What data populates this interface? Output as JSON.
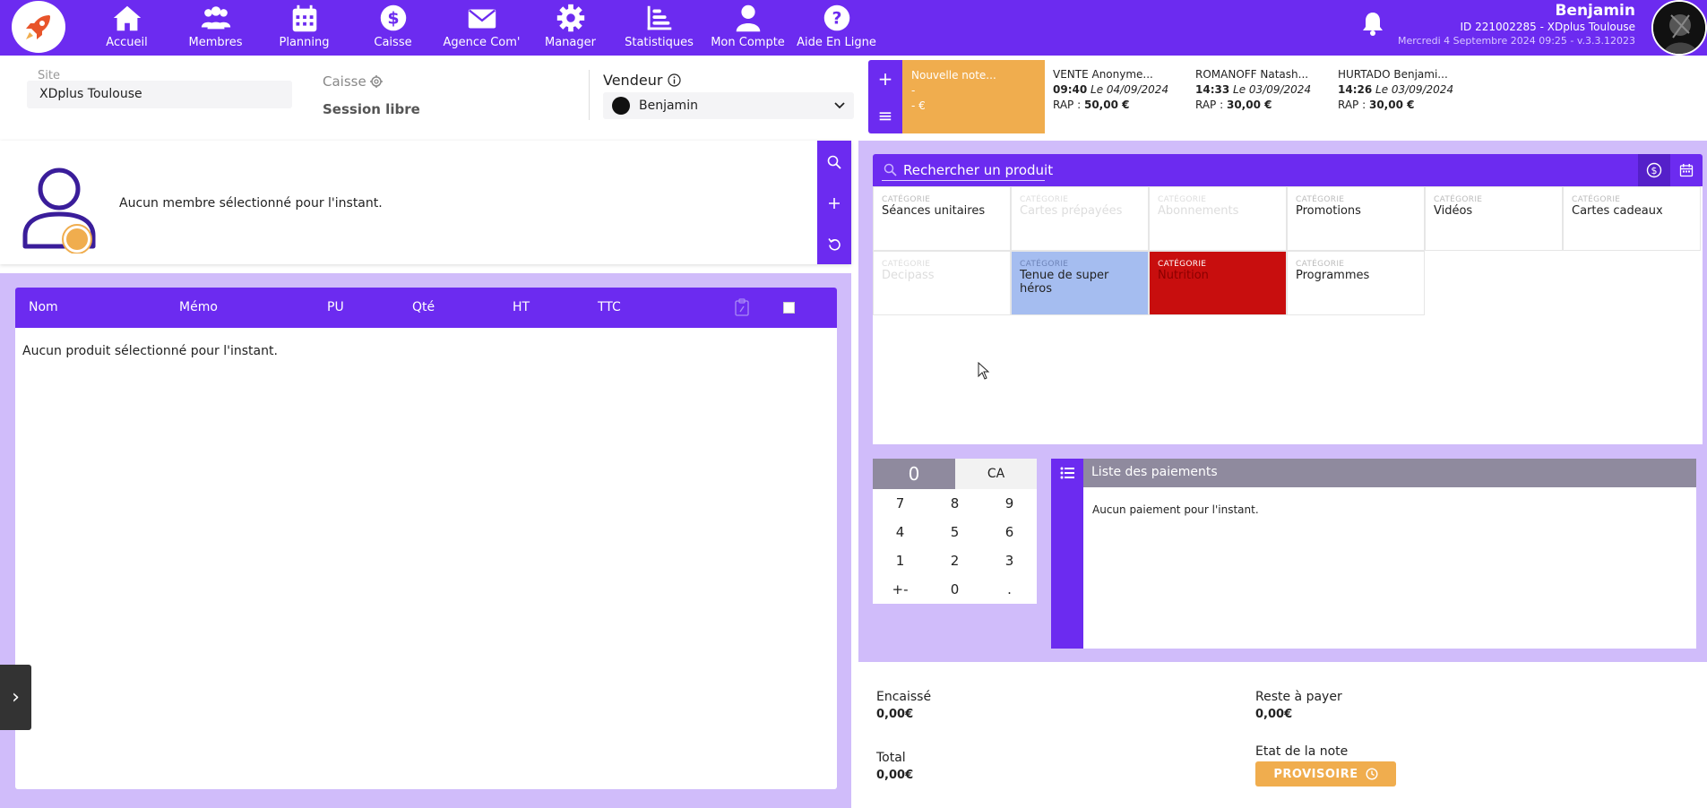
{
  "nav": {
    "items": [
      {
        "label": "Accueil",
        "icon": "home-icon"
      },
      {
        "label": "Membres",
        "icon": "users-icon"
      },
      {
        "label": "Planning",
        "icon": "calendar-icon"
      },
      {
        "label": "Caisse",
        "icon": "dollar-icon"
      },
      {
        "label": "Agence Com'",
        "icon": "envelope-icon"
      },
      {
        "label": "Manager",
        "icon": "gear-icon"
      },
      {
        "label": "Statistiques",
        "icon": "chart-icon"
      },
      {
        "label": "Mon Compte",
        "icon": "user-icon"
      },
      {
        "label": "Aide En Ligne",
        "icon": "help-icon"
      }
    ]
  },
  "user": {
    "name": "Benjamin",
    "id_line": "ID 221002285 - XDplus Toulouse",
    "date_line": "Mercredi 4 Septembre 2024 09:25 - v.3.3.12023"
  },
  "info": {
    "site_label": "Site",
    "site_value": "XDplus Toulouse",
    "caisse_label": "Caisse",
    "session": "Session libre",
    "vendeur_label": "Vendeur",
    "vendeur_value": "Benjamin"
  },
  "notes": {
    "new": {
      "title": "Nouvelle note...",
      "line2": "-",
      "line3": "- €"
    },
    "cards": [
      {
        "name": "VENTE Anonyme...",
        "time": "09:40",
        "date": "Le 04/09/2024",
        "rap_label": "RAP :",
        "rap_value": "50,00 €"
      },
      {
        "name": "ROMANOFF Natash...",
        "time": "14:33",
        "date": "Le 03/09/2024",
        "rap_label": "RAP :",
        "rap_value": "30,00 €"
      },
      {
        "name": "HURTADO Benjami...",
        "time": "14:26",
        "date": "Le 03/09/2024",
        "rap_label": "RAP :",
        "rap_value": "30,00 €"
      }
    ]
  },
  "member": {
    "empty_text": "Aucun membre sélectionné pour l'instant."
  },
  "products": {
    "columns": [
      "Nom",
      "Mémo",
      "PU",
      "Qté",
      "HT",
      "TTC"
    ],
    "empty_text": "Aucun produit sélectionné pour l'instant."
  },
  "catalog": {
    "search_placeholder": "Rechercher un produit",
    "category_key": "CATÉGORIE",
    "categories": [
      {
        "name": "Séances unitaires",
        "state": "normal"
      },
      {
        "name": "Cartes prépayées",
        "state": "faded"
      },
      {
        "name": "Abonnements",
        "state": "faded"
      },
      {
        "name": "Promotions",
        "state": "normal"
      },
      {
        "name": "Vidéos",
        "state": "normal"
      },
      {
        "name": "Cartes cadeaux",
        "state": "normal"
      },
      {
        "name": "Decipass",
        "state": "faded"
      },
      {
        "name": "Tenue de super héros",
        "state": "blue"
      },
      {
        "name": "Nutrition",
        "state": "red"
      },
      {
        "name": "Programmes",
        "state": "normal"
      }
    ],
    "colors": {
      "blue": "#a5bdf0",
      "red": "#c80e0e"
    }
  },
  "keypad": {
    "display": "0",
    "clear": "CA",
    "keys": [
      "7",
      "8",
      "9",
      "4",
      "5",
      "6",
      "1",
      "2",
      "3",
      "+-",
      "0",
      "."
    ]
  },
  "payments": {
    "title": "Liste des paiements",
    "empty_text": "Aucun paiement pour l'instant."
  },
  "summary": {
    "encaisse_label": "Encaissé",
    "encaisse_value": "0,00€",
    "reste_label": "Reste à payer",
    "reste_value": "0,00€",
    "total_label": "Total",
    "total_value": "0,00€",
    "etat_label": "Etat de la note",
    "etat_value": "PROVISOIRE"
  },
  "colors": {
    "primary": "#6c2bf0",
    "lavender": "#d0bcfa",
    "orange": "#f0ad4e",
    "grey_header": "#8f8a9e"
  }
}
